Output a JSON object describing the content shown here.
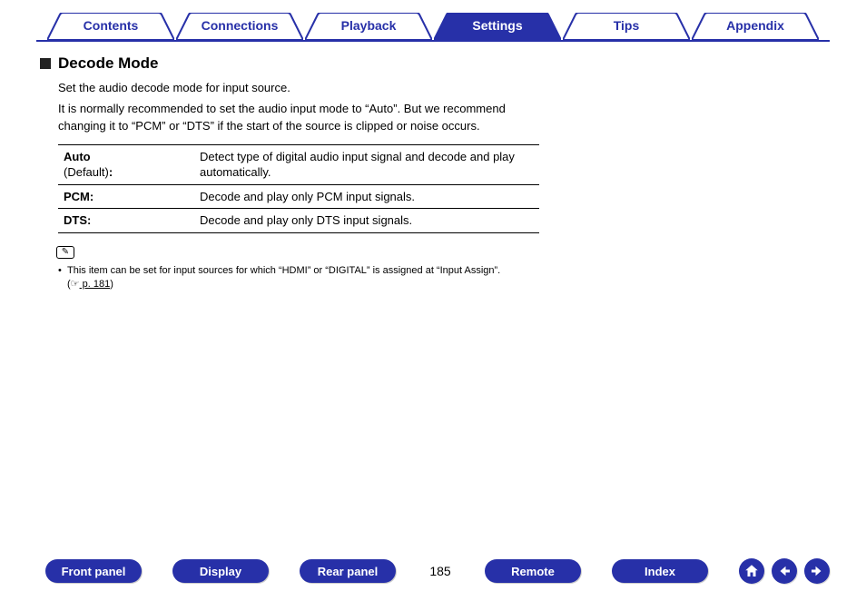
{
  "top_tabs": {
    "contents": "Contents",
    "connections": "Connections",
    "playback": "Playback",
    "settings": "Settings",
    "tips": "Tips",
    "appendix": "Appendix"
  },
  "section": {
    "heading": "Decode Mode",
    "intro": "Set the audio decode mode for input source.",
    "description": "It is normally recommended to set the audio input mode to “Auto”. But we recommend changing it to “PCM” or “DTS” if the start of the source is clipped or noise occurs."
  },
  "table": {
    "row1_label_bold": "Auto",
    "row1_label_light": "(Default)",
    "row1_label_colon": ":",
    "row1_desc": "Detect type of digital audio input signal and decode and play automatically.",
    "row2_label": "PCM:",
    "row2_desc": "Decode and play only PCM input signals.",
    "row3_label": "DTS:",
    "row3_desc": "Decode and play only DTS input signals."
  },
  "note": {
    "text_before": "This item can be set for input sources for which “HDMI” or “DIGITAL” is assigned at “Input Assign”.  (",
    "hand_icon": "☞",
    "page_link": " p. 181",
    "text_after": ")"
  },
  "bottom": {
    "front_panel": "Front panel",
    "display": "Display",
    "rear_panel": "Rear panel",
    "remote": "Remote",
    "index": "Index",
    "page_number": "185"
  },
  "icons": {
    "pencil": "✎"
  }
}
